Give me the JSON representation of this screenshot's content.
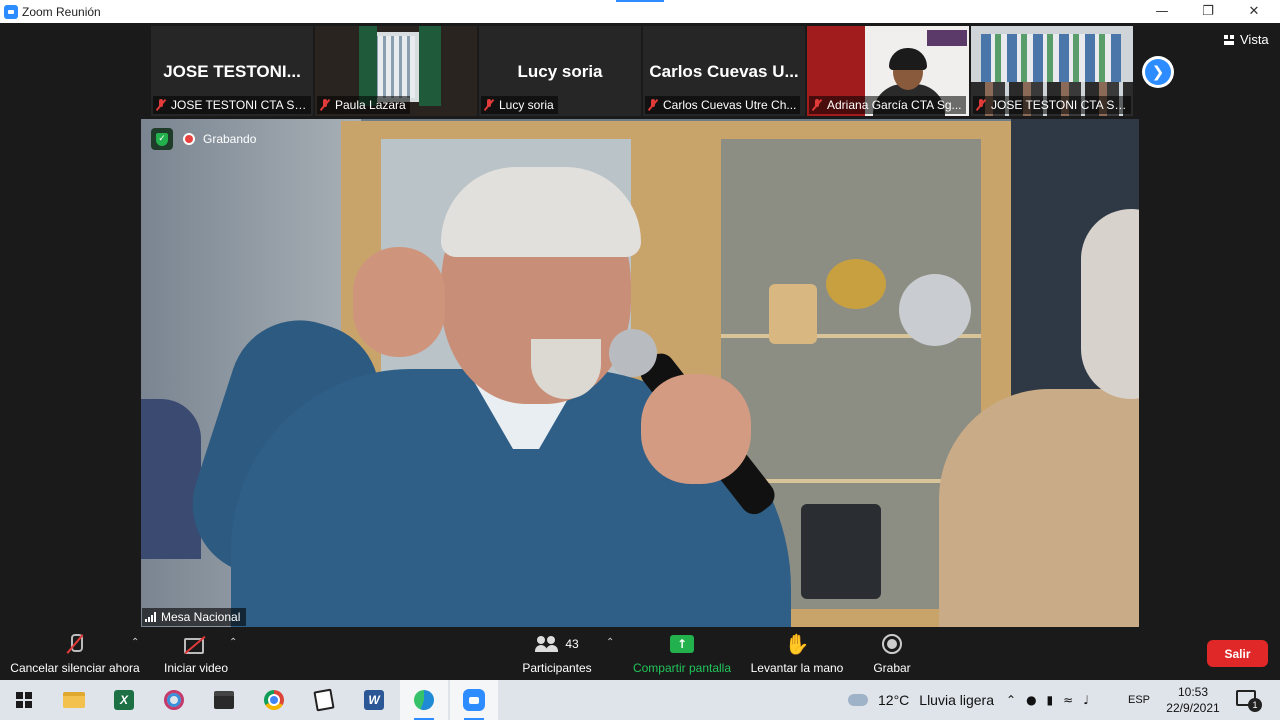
{
  "window": {
    "title": "Zoom Reunión",
    "minimize_icon": "minimize-icon",
    "maximize_icon": "restore-icon",
    "close_icon": "close-icon"
  },
  "view": {
    "label": "Vista"
  },
  "thumbnails": [
    {
      "big_name": "JOSE TESTONI...",
      "caption": "JOSE TESTONI CTA ST..."
    },
    {
      "big_name": "",
      "caption": "Paula Lazara"
    },
    {
      "big_name": "Lucy soria",
      "caption": "Lucy soria"
    },
    {
      "big_name": "Carlos Cuevas U...",
      "caption": "Carlos Cuevas Utre Ch..."
    },
    {
      "big_name": "",
      "caption": "Adriana García CTA Sg..."
    },
    {
      "big_name": "",
      "caption": "JOSE TESTONI CTA Sa..."
    }
  ],
  "main_video": {
    "recording_label": "Grabando",
    "speaker_name": "Mesa Nacional"
  },
  "toolbar": {
    "unmute_label": "Cancelar silenciar ahora",
    "start_video_label": "Iniciar video",
    "participants_label": "Participantes",
    "participants_count": "43",
    "share_label": "Compartir pantalla",
    "raise_hand_label": "Levantar la mano",
    "record_label": "Grabar",
    "leave_label": "Salir"
  },
  "taskbar": {
    "weather_temp": "12°C",
    "weather_text": "Lluvia ligera",
    "language": "ESP",
    "time": "10:53",
    "date": "22/9/2021",
    "notification_count": "1"
  }
}
